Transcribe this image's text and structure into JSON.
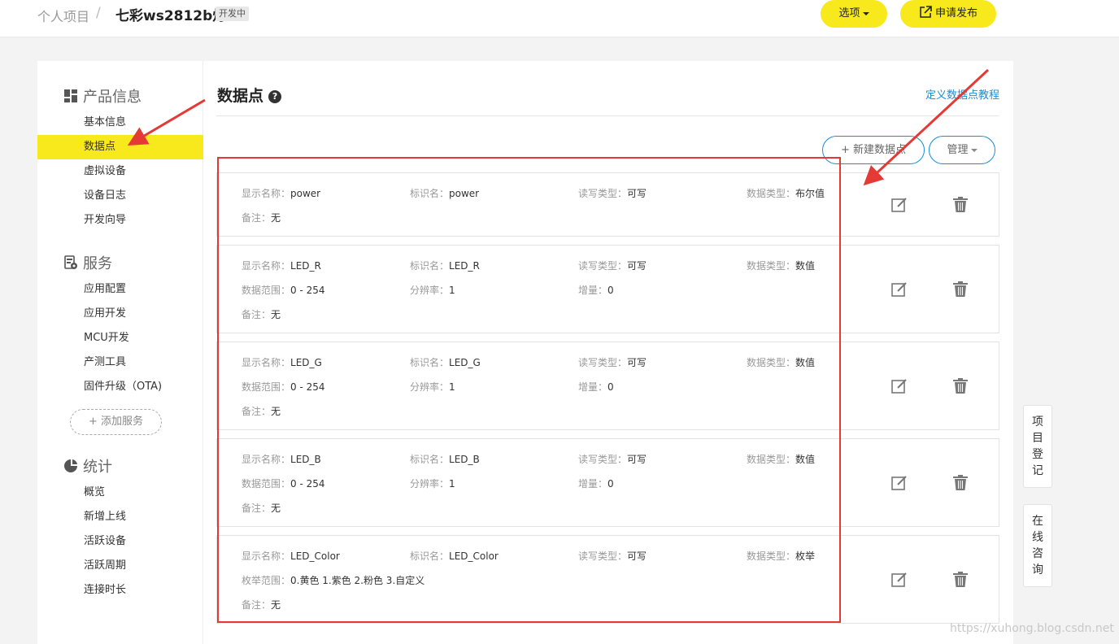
{
  "breadcrumb": {
    "parent": "个人项目",
    "separator": "/",
    "project": "七彩ws2812b灯",
    "status": "开发中"
  },
  "header": {
    "options_label": "选项",
    "publish_label": "申请发布"
  },
  "sidebar": {
    "sections": [
      {
        "title": "产品信息",
        "icon": "grid-icon",
        "items": [
          "基本信息",
          "数据点",
          "虚拟设备",
          "设备日志",
          "开发向导"
        ]
      },
      {
        "title": "服务",
        "icon": "service-icon",
        "items": [
          "应用配置",
          "应用开发",
          "MCU开发",
          "产测工具",
          "固件升级（OTA)"
        ]
      },
      {
        "title": "统计",
        "icon": "pie-chart-icon",
        "items": [
          "概览",
          "新增上线",
          "活跃设备",
          "活跃周期",
          "连接时长"
        ]
      }
    ],
    "active_item": "数据点",
    "add_service": "+ 添加服务"
  },
  "main": {
    "title": "数据点",
    "tutorial_link": "定义数据点教程",
    "new_datapoint": "+ 新建数据点",
    "manage": "管理"
  },
  "datapoints": [
    {
      "display_label": "显示名称：",
      "display": "power",
      "id_label": "标识名：",
      "id": "power",
      "rw_label": "读写类型：",
      "rw": "可写",
      "type_label": "数据类型：",
      "type": "布尔值",
      "note_label": "备注：",
      "note": "无"
    },
    {
      "display_label": "显示名称：",
      "display": "LED_R",
      "id_label": "标识名：",
      "id": "LED_R",
      "rw_label": "读写类型：",
      "rw": "可写",
      "type_label": "数据类型：",
      "type": "数值",
      "range_label": "数据范围：",
      "range": "0 - 254",
      "res_label": "分辨率：",
      "res": "1",
      "inc_label": "增量：",
      "inc": "0",
      "note_label": "备注：",
      "note": "无"
    },
    {
      "display_label": "显示名称：",
      "display": "LED_G",
      "id_label": "标识名：",
      "id": "LED_G",
      "rw_label": "读写类型：",
      "rw": "可写",
      "type_label": "数据类型：",
      "type": "数值",
      "range_label": "数据范围：",
      "range": "0 - 254",
      "res_label": "分辨率：",
      "res": "1",
      "inc_label": "增量：",
      "inc": "0",
      "note_label": "备注：",
      "note": "无"
    },
    {
      "display_label": "显示名称：",
      "display": "LED_B",
      "id_label": "标识名：",
      "id": "LED_B",
      "rw_label": "读写类型：",
      "rw": "可写",
      "type_label": "数据类型：",
      "type": "数值",
      "range_label": "数据范围：",
      "range": "0 - 254",
      "res_label": "分辨率：",
      "res": "1",
      "inc_label": "增量：",
      "inc": "0",
      "note_label": "备注：",
      "note": "无"
    },
    {
      "display_label": "显示名称：",
      "display": "LED_Color",
      "id_label": "标识名：",
      "id": "LED_Color",
      "rw_label": "读写类型：",
      "rw": "可写",
      "type_label": "数据类型：",
      "type": "枚举",
      "enum_label": "枚举范围：",
      "enum": "0.黄色 1.紫色 2.粉色 3.自定义",
      "note_label": "备注：",
      "note": "无"
    }
  ],
  "float_buttons": [
    "项目登记",
    "在线咨询"
  ],
  "watermark": "https://xuhong.blog.csdn.net",
  "colors": {
    "accent_yellow": "#f7e91c",
    "link_blue": "#1a8fd1",
    "annotation_red": "#e53935"
  }
}
